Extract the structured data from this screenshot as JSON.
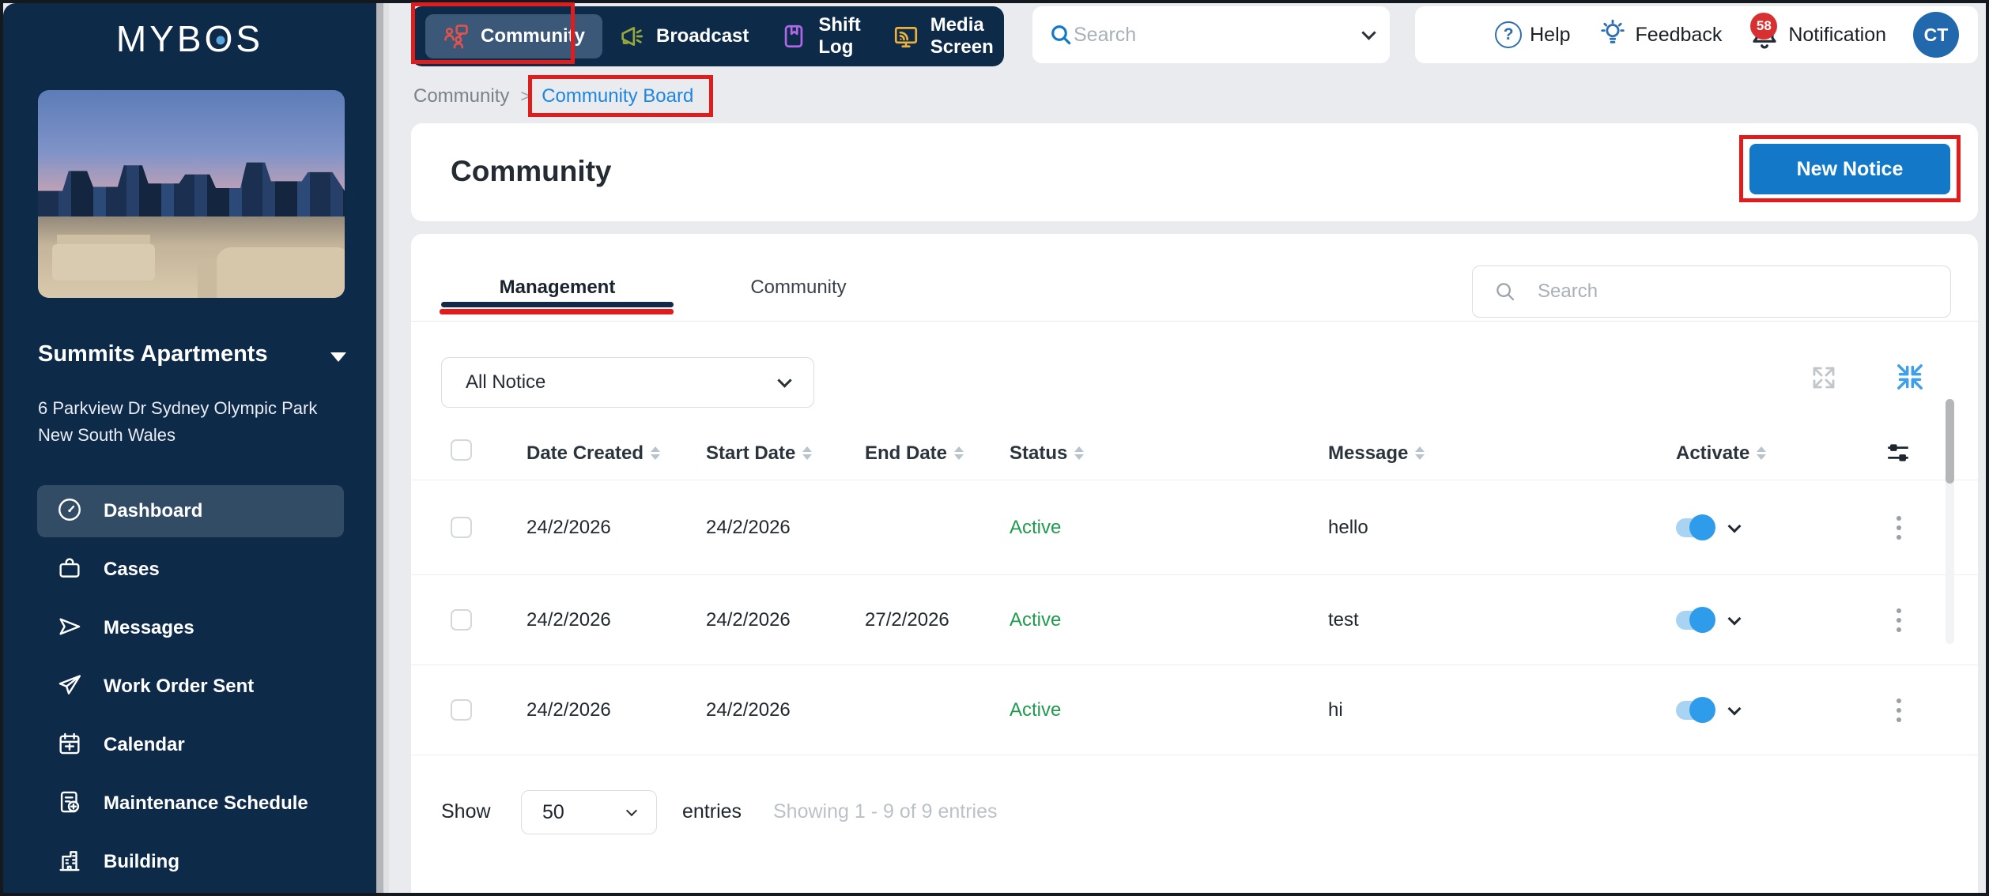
{
  "sidebar": {
    "logo": "MYBOS",
    "building": {
      "name": "Summits Apartments",
      "address_line1": "6 Parkview Dr Sydney Olympic Park",
      "address_line2": "New South Wales"
    },
    "items": [
      {
        "label": "Dashboard",
        "icon": "dashboard-icon",
        "active": true
      },
      {
        "label": "Cases",
        "icon": "briefcase-icon",
        "active": false
      },
      {
        "label": "Messages",
        "icon": "send-icon",
        "active": false
      },
      {
        "label": "Work Order Sent",
        "icon": "paper-plane-icon",
        "active": false
      },
      {
        "label": "Calendar",
        "icon": "calendar-icon",
        "active": false
      },
      {
        "label": "Maintenance Schedule",
        "icon": "maintenance-icon",
        "active": false
      },
      {
        "label": "Building",
        "icon": "building-icon",
        "active": false
      }
    ]
  },
  "topnav": {
    "items": [
      {
        "label": "Community",
        "icon": "community-icon",
        "color": "#e0524e",
        "active": true
      },
      {
        "label": "Broadcast",
        "icon": "megaphone-icon",
        "color": "#97a93a",
        "active": false
      },
      {
        "label": "Shift Log",
        "icon": "book-bookmark-icon",
        "color": "#b168e8",
        "active": false
      },
      {
        "label": "Media Screen",
        "icon": "media-screen-icon",
        "color": "#eab23e",
        "active": false
      }
    ]
  },
  "header": {
    "search_placeholder": "Search",
    "help_label": "Help",
    "feedback_label": "Feedback",
    "notification_label": "Notification",
    "notification_count": "58",
    "avatar_initials": "CT"
  },
  "breadcrumb": {
    "parent": "Community",
    "separator": ">",
    "current": "Community Board"
  },
  "page": {
    "title": "Community",
    "new_notice_button": "New Notice"
  },
  "tabs": {
    "management": "Management",
    "community": "Community"
  },
  "panel": {
    "search_placeholder": "Search",
    "filter_selected": "All Notice"
  },
  "table": {
    "columns": [
      "Date Created",
      "Start Date",
      "End Date",
      "Status",
      "Message",
      "Activate"
    ],
    "rows": [
      {
        "date_created": "24/2/2026",
        "start_date": "24/2/2026",
        "end_date": "",
        "status": "Active",
        "message": "hello",
        "activate": true
      },
      {
        "date_created": "24/2/2026",
        "start_date": "24/2/2026",
        "end_date": "27/2/2026",
        "status": "Active",
        "message": "test",
        "activate": true
      },
      {
        "date_created": "24/2/2026",
        "start_date": "24/2/2026",
        "end_date": "",
        "status": "Active",
        "message": "hi",
        "activate": true
      }
    ]
  },
  "pagination": {
    "show_label": "Show",
    "page_size": "50",
    "entries_label": "entries",
    "summary": "Showing 1 - 9 of 9 entries"
  },
  "colors": {
    "sidebar_navy": "#0d2a49",
    "accent_blue": "#1478c8",
    "link_blue": "#1d86e0",
    "active_green": "#1f9b4e",
    "annotation_red": "#e01c1c",
    "toggle_blue": "#2f9ceb"
  }
}
